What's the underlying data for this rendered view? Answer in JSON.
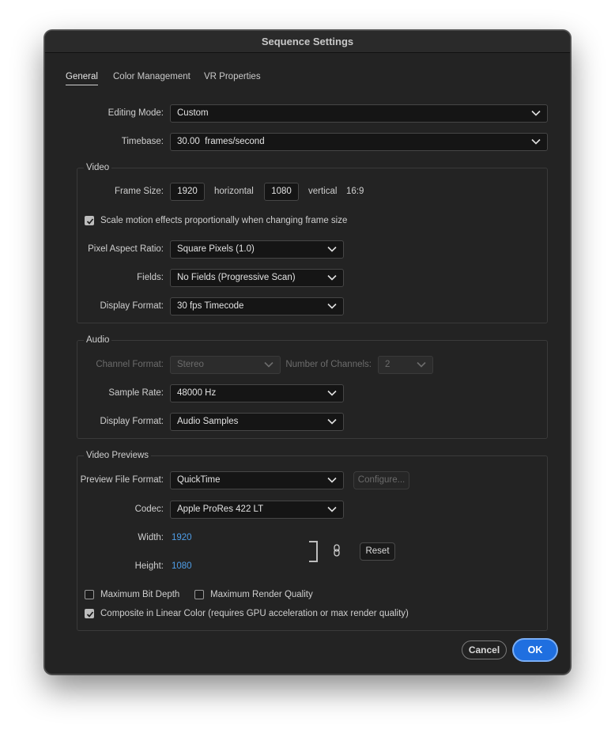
{
  "window": {
    "title": "Sequence Settings"
  },
  "tabs": [
    "General",
    "Color Management",
    "VR Properties"
  ],
  "general": {
    "editing_mode": {
      "label": "Editing Mode:",
      "value": "Custom"
    },
    "timebase": {
      "label": "Timebase:",
      "value": "30.00  frames/second"
    }
  },
  "video": {
    "title": "Video",
    "frame_size": {
      "label": "Frame Size:",
      "width": "1920",
      "horizontal": "horizontal",
      "height": "1080",
      "vertical": "vertical",
      "aspect": "16:9"
    },
    "scale_motion": {
      "label": "Scale motion effects proportionally when changing frame size",
      "checked": true
    },
    "pixel_aspect": {
      "label": "Pixel Aspect Ratio:",
      "value": "Square Pixels (1.0)"
    },
    "fields": {
      "label": "Fields:",
      "value": "No Fields (Progressive Scan)"
    },
    "display_format": {
      "label": "Display Format:",
      "value": "30 fps Timecode"
    }
  },
  "audio": {
    "title": "Audio",
    "channel_format": {
      "label": "Channel Format:",
      "value": "Stereo"
    },
    "num_channels": {
      "label": "Number of Channels:",
      "value": "2"
    },
    "sample_rate": {
      "label": "Sample Rate:",
      "value": "48000 Hz"
    },
    "display_format": {
      "label": "Display Format:",
      "value": "Audio Samples"
    }
  },
  "previews": {
    "title": "Video Previews",
    "file_format": {
      "label": "Preview File Format:",
      "value": "QuickTime"
    },
    "configure": "Configure...",
    "codec": {
      "label": "Codec:",
      "value": "Apple ProRes 422 LT"
    },
    "width": {
      "label": "Width:",
      "value": "1920"
    },
    "height": {
      "label": "Height:",
      "value": "1080"
    },
    "reset": "Reset",
    "max_bit_depth": {
      "label": "Maximum Bit Depth",
      "checked": false
    },
    "max_render_quality": {
      "label": "Maximum Render Quality",
      "checked": false
    },
    "linear_color": {
      "label": "Composite in Linear Color (requires GPU acceleration or max render quality)",
      "checked": true
    }
  },
  "buttons": {
    "cancel": "Cancel",
    "ok": "OK"
  },
  "colors": {
    "accent": "#1f6fe0",
    "link": "#4f9ee8"
  },
  "icons": [
    "chevron-down-icon",
    "checkmark-icon",
    "link-chain-icon"
  ]
}
